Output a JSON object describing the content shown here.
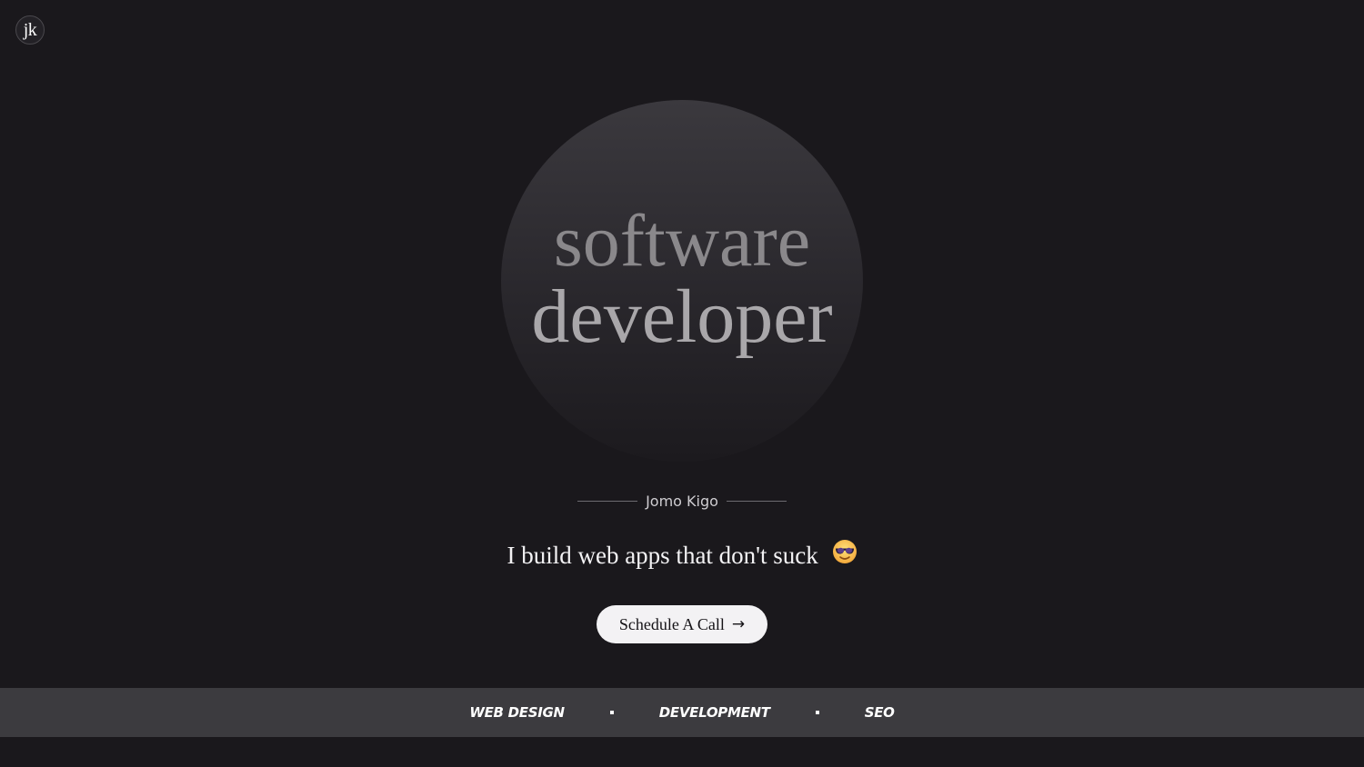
{
  "logo": {
    "text": "jk"
  },
  "hero": {
    "headline_line1": "software",
    "headline_line2": "developer",
    "name": "Jomo Kigo",
    "tagline": "I build web apps that don't suck",
    "tagline_icon": "sunglasses-smile-emoji-icon"
  },
  "cta": {
    "label": "Schedule A Call",
    "icon": "arrow-right-icon"
  },
  "ticker": {
    "items": [
      "WEB DESIGN",
      "DEVELOPMENT",
      "SEO"
    ],
    "separator_icon": "square-bullet-icon"
  },
  "colors": {
    "background": "#1a181c",
    "ticker_background": "#3c3b3f",
    "button_background": "#f3f2f4"
  }
}
